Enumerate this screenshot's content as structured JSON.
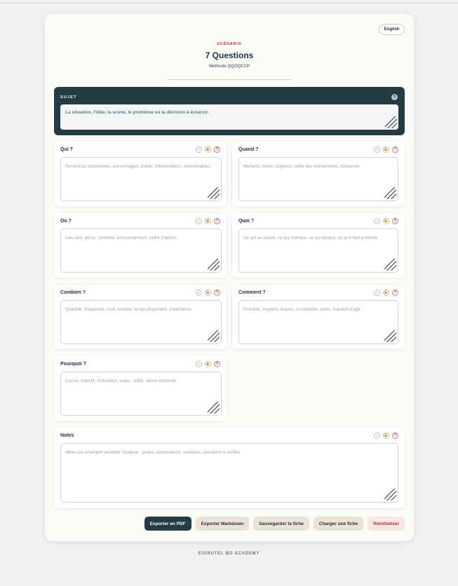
{
  "header": {
    "language": "English",
    "kicker": "SCÉNARIO",
    "title": "7 Questions",
    "subtitle": "Méthode QQOQCCP"
  },
  "subject": {
    "label": "SUJET",
    "help": "?",
    "placeholder": "La situation, l'idée, la scène, le problème ou la décision à éclaircir."
  },
  "icons": {
    "collapse": "chevron-down-icon",
    "lock": "lock-icon",
    "help": "help-icon"
  },
  "questions": {
    "qui": {
      "label": "Qui ?",
      "placeholder": "Personnes concernées, personnages, public, interlocuteurs, responsables."
    },
    "quand": {
      "label": "Quand ?",
      "placeholder": "Moment, durée, urgence, ordre des événements, échéance."
    },
    "ou": {
      "label": "Où ?",
      "placeholder": "Lieu réel, décor, contexte, environnement, cadre d'action."
    },
    "quoi": {
      "label": "Quoi ?",
      "placeholder": "Ce qui se passe, ce qui manque, ce qui bloque, ce qu'il faut produire."
    },
    "combien": {
      "label": "Combien ?",
      "placeholder": "Quantité, fréquence, coût, volume, temps disponible, importance."
    },
    "comment": {
      "label": "Comment ?",
      "placeholder": "Procédé, moyens, étapes, contraintes, outils, manière d'agir."
    },
    "pourquoi": {
      "label": "Pourquoi ?",
      "placeholder": "Cause, objectif, motivation, enjeu, utilité, raison profonde."
    },
    "notes": {
      "label": "Notes",
      "placeholder": "Idées qui émergent pendant l'analyse : pistes, associations, solutions, questions à vérifier."
    }
  },
  "actions": {
    "export_pdf": "Exporter en PDF",
    "export_md": "Exporter Markdown",
    "save": "Sauvegarder la fiche",
    "load": "Charger une fiche",
    "reset": "Réinitialiser"
  },
  "footer": "EIGRUTEL BD ACADEMY"
}
